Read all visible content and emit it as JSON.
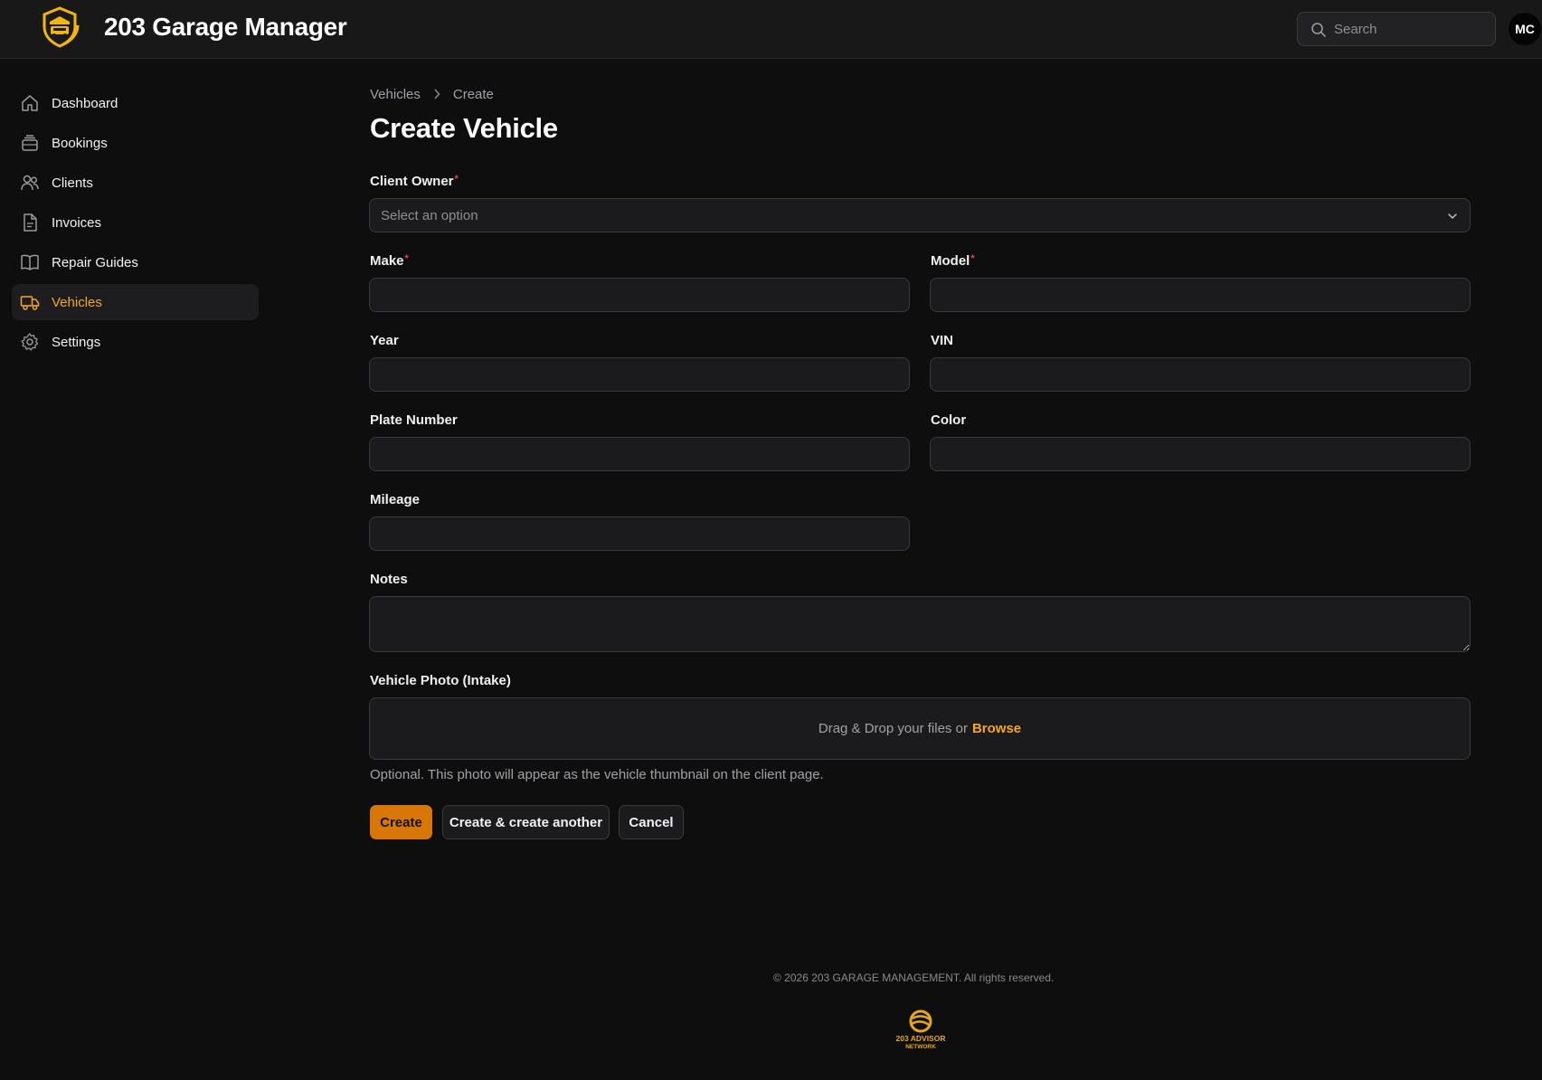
{
  "header": {
    "app_title": "203 Garage Manager",
    "search_placeholder": "Search",
    "avatar_initials": "MC",
    "logo_icon": "garage-shield-logo"
  },
  "sidebar": {
    "items": [
      {
        "label": "Dashboard",
        "icon": "home-icon",
        "active": false
      },
      {
        "label": "Bookings",
        "icon": "inbox-stack-icon",
        "active": false
      },
      {
        "label": "Clients",
        "icon": "users-icon",
        "active": false
      },
      {
        "label": "Invoices",
        "icon": "document-icon",
        "active": false
      },
      {
        "label": "Repair Guides",
        "icon": "book-icon",
        "active": false
      },
      {
        "label": "Vehicles",
        "icon": "truck-icon",
        "active": true
      },
      {
        "label": "Settings",
        "icon": "gear-icon",
        "active": false
      }
    ],
    "active_color": "#f5a623"
  },
  "breadcrumb": {
    "items": [
      "Vehicles",
      "Create"
    ],
    "separator": ">"
  },
  "page": {
    "title": "Create Vehicle"
  },
  "form": {
    "client_owner": {
      "label": "Client Owner",
      "required_mark": "*",
      "placeholder": "Select an option"
    },
    "make": {
      "label": "Make",
      "required_mark": "*",
      "value": ""
    },
    "model": {
      "label": "Model",
      "required_mark": "*",
      "value": ""
    },
    "year": {
      "label": "Year",
      "value": ""
    },
    "vin": {
      "label": "VIN",
      "value": ""
    },
    "plate_number": {
      "label": "Plate Number",
      "value": ""
    },
    "color": {
      "label": "Color",
      "value": ""
    },
    "mileage": {
      "label": "Mileage",
      "value": ""
    },
    "notes": {
      "label": "Notes",
      "value": ""
    },
    "vehicle_photo": {
      "label": "Vehicle Photo (Intake)",
      "dropzone_text": "Drag & Drop your files or",
      "browse_label": "Browse",
      "helper_text": "Optional. This photo will appear as the vehicle thumbnail on the client page."
    }
  },
  "actions": {
    "create_label": "Create",
    "create_another_label": "Create & create another",
    "cancel_label": "Cancel"
  },
  "footer": {
    "copyright": "© 2026 203 GARAGE MANAGEMENT. All rights reserved.",
    "network_logo_line1": "203 ADVISOR",
    "network_logo_line2": "NETWORK"
  },
  "colors": {
    "accent": "#f5a623",
    "primary_button": "#d97706",
    "background": "#0e0e0f",
    "required": "#ef4444"
  }
}
